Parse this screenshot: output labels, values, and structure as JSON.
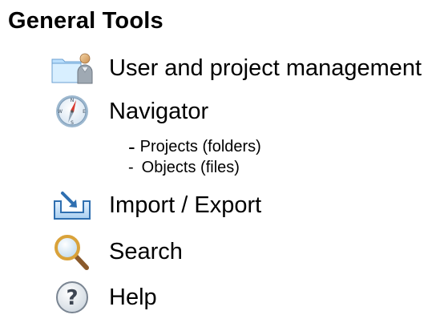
{
  "page": {
    "title": "General Tools"
  },
  "tools": [
    {
      "label": "User and project management",
      "icon": "user-folder-icon"
    },
    {
      "label": "Navigator",
      "icon": "compass-icon",
      "sub_items": [
        {
          "dash": "-",
          "label": "Projects (folders)"
        },
        {
          "dash": "-",
          "label": "Objects (files)"
        }
      ]
    },
    {
      "label": "Import / Export",
      "icon": "import-export-icon"
    },
    {
      "label": "Search",
      "icon": "magnifier-icon"
    },
    {
      "label": "Help",
      "icon": "help-icon"
    }
  ],
  "colors": {
    "text": "#000000",
    "background": "#ffffff",
    "accent_blue": "#3f8fd2",
    "accent_red": "#d83a2f"
  }
}
